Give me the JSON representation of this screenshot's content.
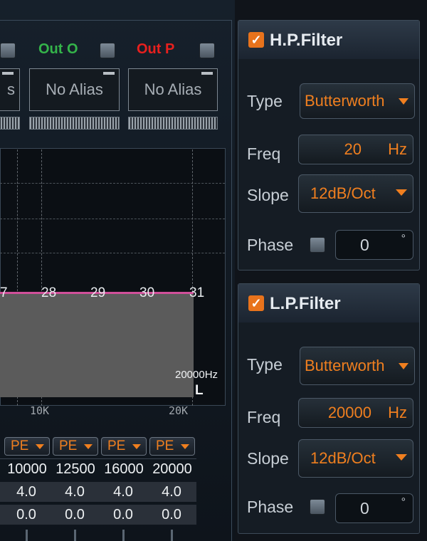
{
  "outputs": [
    {
      "label_word": "Out",
      "label_letter": "O",
      "color": "#34b44a",
      "alias": "No Alias"
    },
    {
      "label_word": "Out",
      "label_letter": "P",
      "color": "#e8201e",
      "alias": "No Alias"
    }
  ],
  "partial_alias": "s",
  "graph": {
    "band_labels": [
      "7",
      "28",
      "29",
      "30",
      "31"
    ],
    "freq_note": "20000Hz",
    "channel_mark": "L",
    "axis_labels": [
      "10K",
      "20K"
    ]
  },
  "eq_table": {
    "type_buttons": [
      "PE",
      "PE",
      "PE",
      "PE"
    ],
    "freqs": [
      "10000",
      "12500",
      "16000",
      "20000"
    ],
    "gains": [
      "4.0",
      "4.0",
      "4.0",
      "4.0"
    ],
    "qs": [
      "0.0",
      "0.0",
      "0.0",
      "0.0"
    ]
  },
  "hp_filter": {
    "title": "H.P.Filter",
    "checked": true,
    "type_label": "Type",
    "type_value": "Butterworth",
    "freq_label": "Freq",
    "freq_value": "20",
    "freq_unit": "Hz",
    "slope_label": "Slope",
    "slope_value": "12dB/Oct",
    "phase_label": "Phase",
    "phase_value": "0",
    "phase_unit": "°"
  },
  "lp_filter": {
    "title": "L.P.Filter",
    "checked": true,
    "type_label": "Type",
    "type_value": "Butterworth",
    "freq_label": "Freq",
    "freq_value": "20000",
    "freq_unit": "Hz",
    "slope_label": "Slope",
    "slope_value": "12dB/Oct",
    "phase_label": "Phase",
    "phase_value": "0",
    "phase_unit": "°"
  }
}
